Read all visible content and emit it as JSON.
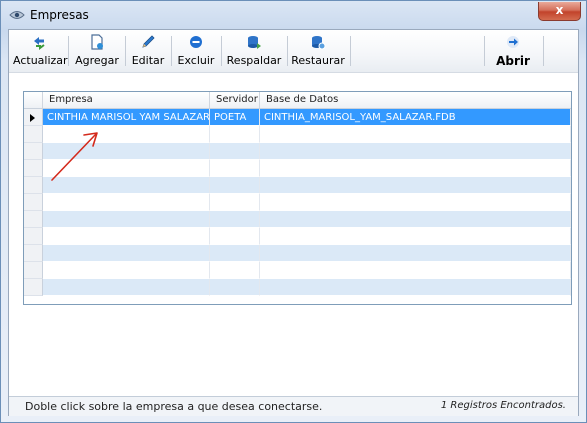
{
  "window": {
    "title": "Empresas",
    "close_label": "x"
  },
  "toolbar": {
    "buttons": [
      {
        "label": "Actualizar",
        "icon": "refresh-arrows-icon"
      },
      {
        "label": "Agregar",
        "icon": "new-document-icon"
      },
      {
        "label": "Editar",
        "icon": "pencil-icon"
      },
      {
        "label": "Excluir",
        "icon": "remove-circle-icon"
      },
      {
        "label": "Respaldar",
        "icon": "database-backup-icon"
      },
      {
        "label": "Restaurar",
        "icon": "database-restore-icon"
      }
    ],
    "open": {
      "label": "Abrir",
      "icon": "open-arrow-icon"
    }
  },
  "grid": {
    "columns": [
      "Empresa",
      "Servidor",
      "Base de Datos"
    ],
    "rows": [
      {
        "empresa": "CINTHIA MARISOL YAM SALAZAR",
        "servidor": "POETA",
        "base_datos": "CINTHIA_MARISOL_YAM_SALAZAR.FDB",
        "selected": true
      }
    ],
    "empty_rows": 10
  },
  "status": {
    "hint": "Doble click sobre la empresa a que desea conectarse.",
    "count": "1 Registros Encontrados."
  },
  "colors": {
    "selection": "#3399ff",
    "alt_row": "#dbe9f7",
    "annotation": "#d42a1c"
  }
}
